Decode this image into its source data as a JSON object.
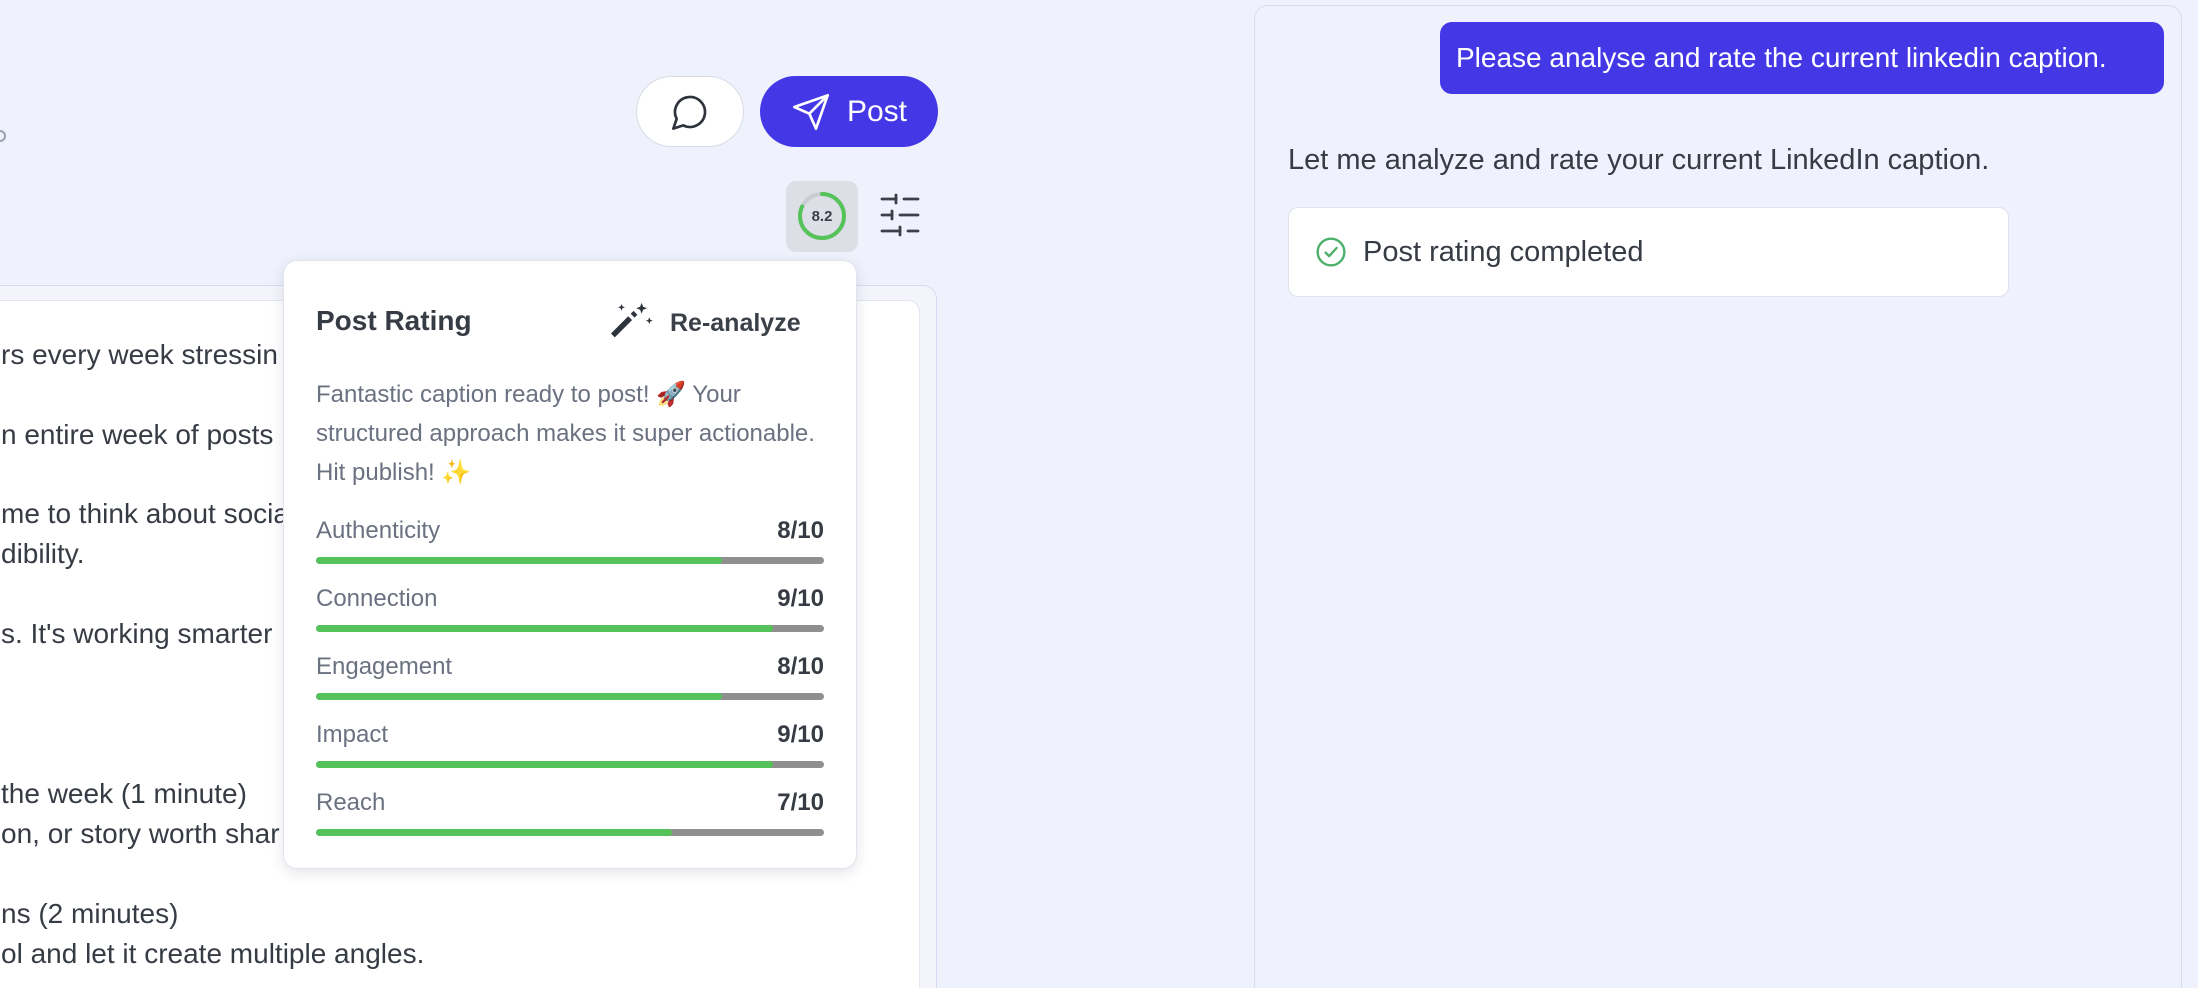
{
  "toolbar": {
    "comment_icon": "speech-bubble-icon",
    "post_icon": "paper-plane-icon",
    "post_label": "Post",
    "score": "8.2",
    "score_value": 8.2,
    "score_max": 10,
    "settings_icon": "sliders-icon"
  },
  "editor": {
    "lines": [
      "rs every week stressin",
      "n entire week of posts",
      "me to think about socia",
      "dibility.",
      "s. It's working smarter",
      " the week (1 minute)",
      "on, or story worth shar",
      "ns (2 minutes)",
      "ol and let it create multiple angles."
    ]
  },
  "rating": {
    "title": "Post Rating",
    "reanalyze_label": "Re-analyze",
    "reanalyze_icon": "magic-wand-icon",
    "summary": "Fantastic caption ready to post! 🚀 Your structured approach makes it super actionable. Hit publish! ✨",
    "metrics": [
      {
        "label": "Authenticity",
        "score": "8/10",
        "value": 8
      },
      {
        "label": "Connection",
        "score": "9/10",
        "value": 9
      },
      {
        "label": "Engagement",
        "score": "8/10",
        "value": 8
      },
      {
        "label": "Impact",
        "score": "9/10",
        "value": 9
      },
      {
        "label": "Reach",
        "score": "7/10",
        "value": 7
      }
    ],
    "colors": {
      "fill": "#55c35a",
      "track": "#8f8f8f"
    }
  },
  "chat": {
    "user_message": "Please analyse and rate the current linkedin caption.",
    "assistant_message": "Let me analyze and rate your current LinkedIn caption.",
    "status": {
      "icon": "check-circle-icon",
      "text": "Post rating completed"
    }
  },
  "colors": {
    "accent": "#4337e6",
    "success": "#55c35a",
    "background": "#eff1fc"
  }
}
